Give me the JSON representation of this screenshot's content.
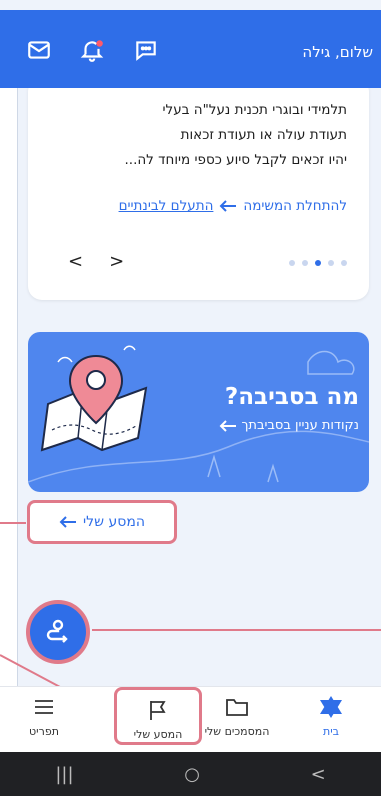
{
  "header": {
    "greeting": "שלום, גילה",
    "icons": [
      "mail-icon",
      "bell-icon",
      "chat-icon"
    ],
    "accent": "#2f6ee8"
  },
  "card": {
    "lines": [
      "תלמידי ובוגרי תכנית נעל\"ה בעלי",
      "תעודת עולה או תעודת זכאות",
      "יהיו זכאים לקבל סיוע כספי מיוחד לה..."
    ],
    "start_task": "להתחלת המשימה",
    "dismiss": "התעלם לבינתיים",
    "prev": "<",
    "next": ">",
    "dot_count": 5,
    "active_dot": 2
  },
  "promo": {
    "title": "מה בסביבה?",
    "subtitle": "נקודות עניין בסביבתך"
  },
  "journey_chip": {
    "label": "המסע שלי"
  },
  "bottom_nav": {
    "items": [
      {
        "label": "בית",
        "icon": "star-of-david-icon"
      },
      {
        "label": "המסמכים שלי",
        "icon": "folder-icon"
      },
      {
        "label": "המסע שלי",
        "icon": "flag-icon"
      },
      {
        "label": "תפריט",
        "icon": "menu-icon"
      }
    ]
  },
  "system_bar": {
    "recent": "|||",
    "home": "○",
    "back": "<"
  },
  "colors": {
    "highlight": "#e07a8a",
    "primary": "#2f6ee8",
    "promo_bg": "#4f86ee"
  }
}
